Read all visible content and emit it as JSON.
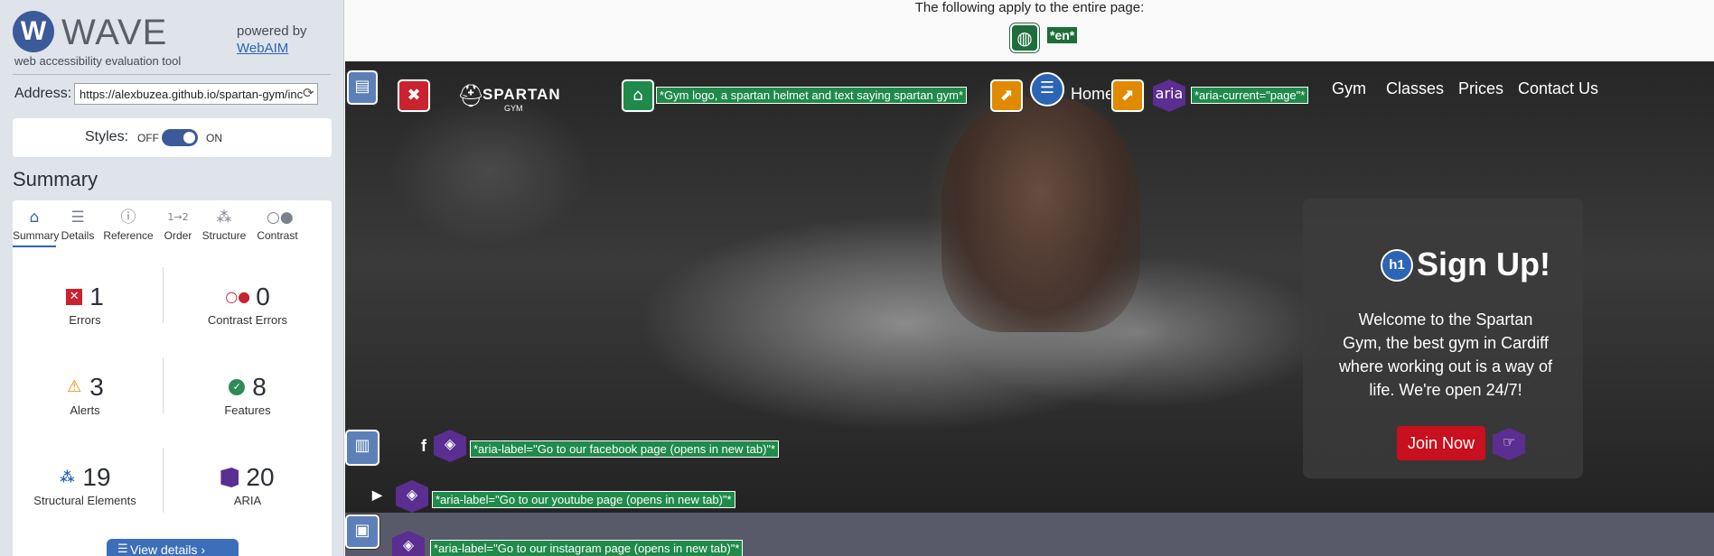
{
  "wave": {
    "brand_logo": "W",
    "brand_name": "WAVE",
    "tagline": "web accessibility evaluation tool",
    "powered_by": "powered by",
    "webaim": "WebAIM",
    "address_label": "Address:",
    "address_value": "https://alexbuzea.github.io/spartan-gym/inc",
    "styles_label": "Styles:",
    "styles_off": "OFF",
    "styles_on": "ON",
    "summary_title": "Summary",
    "tabs": [
      {
        "label": "Summary",
        "icon": "home-icon"
      },
      {
        "label": "Details",
        "icon": "list-icon"
      },
      {
        "label": "Reference",
        "icon": "info-icon"
      },
      {
        "label": "Order",
        "icon": "order-icon"
      },
      {
        "label": "Structure",
        "icon": "structure-icon"
      },
      {
        "label": "Contrast",
        "icon": "contrast-icon"
      }
    ],
    "stats": {
      "errors": {
        "count": "1",
        "label": "Errors"
      },
      "contrast": {
        "count": "0",
        "label": "Contrast Errors"
      },
      "alerts": {
        "count": "3",
        "label": "Alerts"
      },
      "features": {
        "count": "8",
        "label": "Features"
      },
      "structural": {
        "count": "19",
        "label": "Structural Elements"
      },
      "aria": {
        "count": "20",
        "label": "ARIA"
      }
    },
    "view_details": "View details ›"
  },
  "page": {
    "notice": "The following apply to the entire page:",
    "lang_label": "*en*",
    "logo_text": "SPARTAN",
    "logo_sub": "GYM",
    "alt_label": "*Gym logo, a spartan helmet and text saying spartan gym*",
    "home": "Home",
    "aria_badge": "aria",
    "aria_current": "*aria-current=\"page\"*",
    "nav": [
      "Gym",
      "Classes",
      "Prices",
      "Contact Us"
    ],
    "h1_badge": "h1",
    "signup_title": "Sign Up!",
    "signup_text": "Welcome to the Spartan Gym, the best gym in Cardiff where working out is a way of life. We're open 24/7!",
    "join_now": "Join Now",
    "fb_label": "*aria-label=\"Go to our facebook page (opens in new tab)\"*",
    "yt_label": "*aria-label=\"Go to our youtube page (opens in new tab)\"*",
    "ig_label": "*aria-label=\"Go to our instagram page (opens in new tab)\"*"
  },
  "colors": {
    "wave_blue": "#3c5a99",
    "error_red": "#c8232e",
    "feature_green": "#1f8a4a",
    "alert_orange": "#e08a00",
    "aria_purple": "#5b2e91",
    "join_red": "#c8101e"
  }
}
